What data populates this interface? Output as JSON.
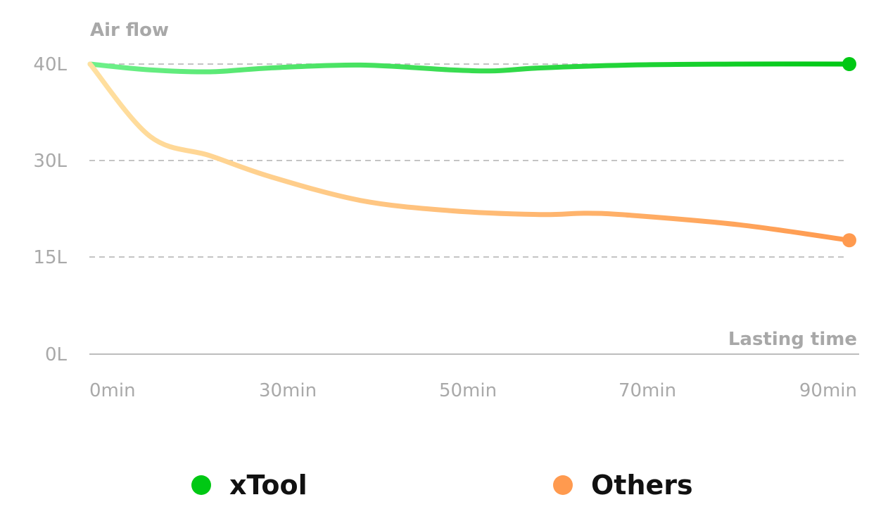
{
  "chart_data": {
    "type": "line",
    "title": "",
    "ylabel": "Air flow",
    "xlabel": "Lasting time",
    "y_ticks": [
      {
        "value": 40,
        "label": "40L"
      },
      {
        "value": 30,
        "label": "30L"
      },
      {
        "value": 15,
        "label": "15L"
      },
      {
        "value": 0,
        "label": "0L"
      }
    ],
    "x_ticks": [
      {
        "value": 0,
        "label": "0min"
      },
      {
        "value": 30,
        "label": "30min"
      },
      {
        "value": 50,
        "label": "50min"
      },
      {
        "value": 70,
        "label": "70min"
      },
      {
        "value": 90,
        "label": "90min"
      }
    ],
    "ylim": [
      0,
      40
    ],
    "xlim": [
      0,
      90
    ],
    "grid": true,
    "legend_position": "bottom",
    "series": [
      {
        "name": "xTool",
        "color": "#00c814",
        "color_start": "#6ef08a",
        "x": [
          0,
          10,
          20,
          30,
          40,
          50,
          55,
          60,
          70,
          80,
          90
        ],
        "y": [
          40,
          39.4,
          39.2,
          39.6,
          39.9,
          39.4,
          39.3,
          39.6,
          39.9,
          40,
          40
        ]
      },
      {
        "name": "Others",
        "color": "#ff9a4f",
        "color_start": "#ffe0a0",
        "x": [
          0,
          10,
          20,
          30,
          40,
          50,
          60,
          65,
          70,
          80,
          90
        ],
        "y": [
          40,
          32.5,
          30.5,
          27.5,
          23.8,
          22.2,
          21.6,
          21.8,
          21.5,
          20.0,
          17.6
        ]
      }
    ]
  },
  "legend": [
    {
      "label": "xTool",
      "color": "#00c814"
    },
    {
      "label": "Others",
      "color": "#ff9a4f"
    }
  ]
}
